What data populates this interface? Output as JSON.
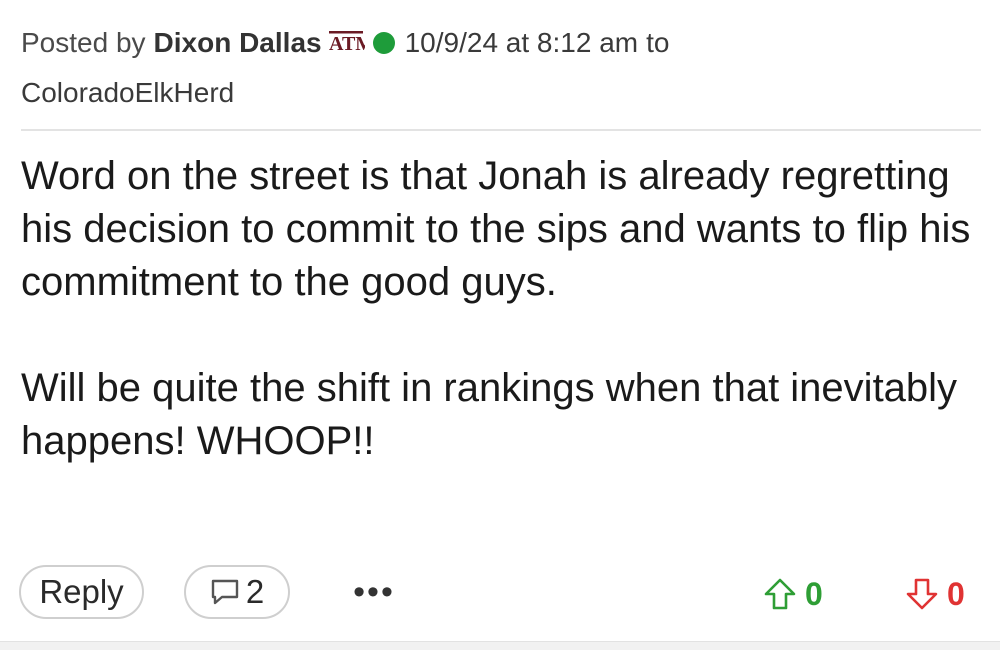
{
  "post": {
    "posted_by_label": "Posted by",
    "author": "Dixon Dallas",
    "team_logo_icon": "texas-am-logo-icon",
    "team_logo_text": "ATM",
    "online_status_color": "#1e9c3a",
    "timestamp": "10/9/24 at 8:12 am",
    "to_label": "to",
    "recipient": "ColoradoElkHerd",
    "body": [
      "Word on the street is that Jonah is already regretting his decision to commit to the sips and wants to flip his commitment to the good guys.",
      "Will be quite the shift in rankings when that inevitably happens! WHOOP!!"
    ]
  },
  "actions": {
    "reply_label": "Reply",
    "comment_icon": "comment-icon",
    "comment_count": "2",
    "more_label": "•••",
    "upvote_icon": "arrow-up-icon",
    "upvote_count": "0",
    "upvote_color": "#2e9e35",
    "downvote_icon": "arrow-down-icon",
    "downvote_count": "0",
    "downvote_color": "#e03333"
  }
}
